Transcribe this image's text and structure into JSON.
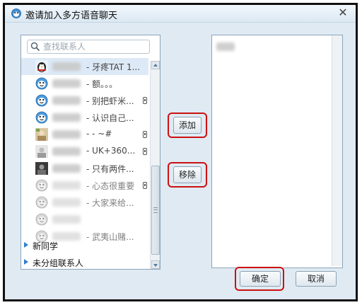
{
  "window": {
    "title": "邀请加入多方语音聊天",
    "close_glyph": "✕"
  },
  "search": {
    "placeholder": "查找联系人"
  },
  "contacts": [
    {
      "status": "-  牙疼TAT  1...",
      "avatar": "penguin-avatar",
      "phone": false,
      "faded": false,
      "selected": true
    },
    {
      "status": "-  额。。。",
      "avatar": "qq-face-avatar",
      "phone": false,
      "faded": false,
      "selected": false
    },
    {
      "status": "-  别把虾米...",
      "avatar": "qq-face-avatar",
      "phone": true,
      "faded": false,
      "selected": false
    },
    {
      "status": "-  认识自己...",
      "avatar": "qq-face-avatar",
      "phone": false,
      "faded": false,
      "selected": false
    },
    {
      "status": "-  - ~#",
      "avatar": "photo-avatar",
      "phone": true,
      "faded": false,
      "selected": false
    },
    {
      "status": "-  UK+360...",
      "avatar": "photo-avatar-gray",
      "phone": true,
      "faded": false,
      "selected": false
    },
    {
      "status": "-  只有两件...",
      "avatar": "photo-avatar-dark",
      "phone": false,
      "faded": false,
      "selected": false
    },
    {
      "status": "-  心态很重要",
      "avatar": "qq-face-avatar-offline",
      "phone": true,
      "faded": true,
      "selected": false
    },
    {
      "status": "-  大家来给...",
      "avatar": "qq-face-avatar-offline",
      "phone": false,
      "faded": true,
      "selected": false
    },
    {
      "status": "",
      "avatar": "qq-face-avatar-offline",
      "phone": false,
      "faded": true,
      "selected": false
    },
    {
      "status": "-  武夷山赌...",
      "avatar": "qq-face-avatar-offline",
      "phone": false,
      "faded": true,
      "selected": false
    }
  ],
  "groups": [
    {
      "label": "新同学"
    },
    {
      "label": "未分组联系人"
    }
  ],
  "buttons": {
    "add": "添加",
    "remove": "移除",
    "ok": "确定",
    "cancel": "取消"
  },
  "colors": {
    "highlight_ring": "#cc1111",
    "window_bg": "#dfeaf3",
    "group_arrow": "#2f7fcf"
  }
}
